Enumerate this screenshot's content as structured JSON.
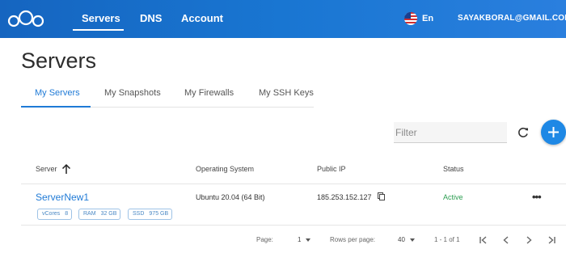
{
  "nav": {
    "items": [
      {
        "label": "Servers",
        "active": true
      },
      {
        "label": "DNS",
        "active": false
      },
      {
        "label": "Account",
        "active": false
      }
    ],
    "language": "En",
    "user_email": "SAYAKBORAL@GMAIL.COM",
    "logo_icon": "three-circles-logo-icon",
    "flag_icon": "us-flag-icon"
  },
  "page": {
    "title": "Servers",
    "tabs": [
      {
        "label": "My Servers",
        "active": true
      },
      {
        "label": "My Snapshots",
        "active": false
      },
      {
        "label": "My Firewalls",
        "active": false
      },
      {
        "label": "My SSH Keys",
        "active": false
      }
    ]
  },
  "toolbar": {
    "filter_placeholder": "Filter",
    "refresh_icon": "refresh-icon",
    "add_icon": "plus-icon"
  },
  "table": {
    "columns": [
      "Server",
      "Operating System",
      "Public IP",
      "Status"
    ],
    "sort_icon": "arrow-up-icon",
    "rows": [
      {
        "server": "ServerNew1",
        "chips": [
          {
            "label": "vCores",
            "value": "8"
          },
          {
            "label": "RAM",
            "value": "32 GB"
          },
          {
            "label": "SSD",
            "value": "975 GB"
          }
        ],
        "os": "Ubuntu 20.04 (64 Bit)",
        "ip": "185.253.152.127",
        "status": "Active",
        "more_icon": "more-horizontal-icon"
      }
    ]
  },
  "pagination": {
    "page_label": "Page:",
    "page_value": "1",
    "rows_label": "Rows per page:",
    "rows_value": "40",
    "range": "1 - 1 of 1"
  },
  "colors": {
    "brand": "#1976d2",
    "accent": "#1f7ad6",
    "status_active": "#2e9e52"
  }
}
